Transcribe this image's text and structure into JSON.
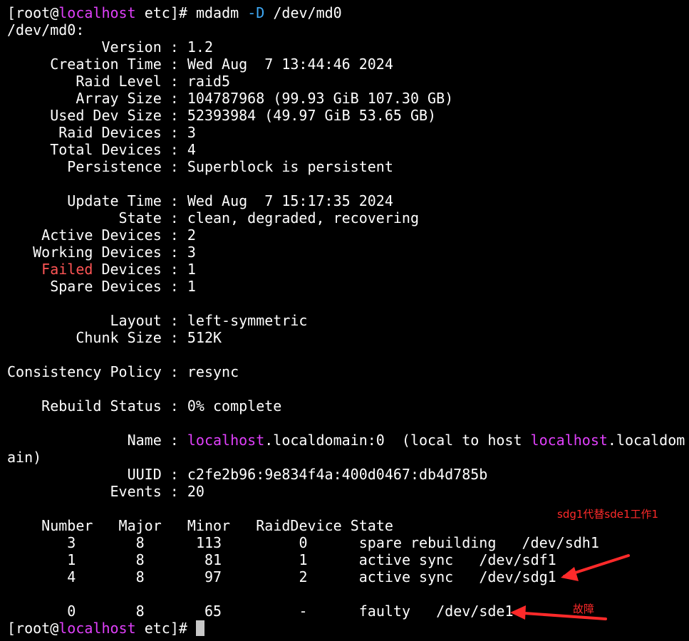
{
  "prompt": {
    "user": "root",
    "host": "localhost",
    "dir": "etc",
    "symbol": "#"
  },
  "command": {
    "name": "mdadm",
    "flag": "-D",
    "target": "/dev/md0"
  },
  "device_header": "/dev/md0:",
  "details1": [
    {
      "key": "Version",
      "value": "1.2"
    },
    {
      "key": "Creation Time",
      "value": "Wed Aug  7 13:44:46 2024"
    },
    {
      "key": "Raid Level",
      "value": "raid5"
    },
    {
      "key": "Array Size",
      "value": "104787968 (99.93 GiB 107.30 GB)"
    },
    {
      "key": "Used Dev Size",
      "value": "52393984 (49.97 GiB 53.65 GB)"
    },
    {
      "key": "Raid Devices",
      "value": "3"
    },
    {
      "key": "Total Devices",
      "value": "4"
    },
    {
      "key": "Persistence",
      "value": "Superblock is persistent"
    }
  ],
  "details2": [
    {
      "key": "Update Time",
      "value": "Wed Aug  7 15:17:35 2024"
    },
    {
      "key": "State",
      "value": "clean, degraded, recovering"
    },
    {
      "key": "Active Devices",
      "value": "2"
    },
    {
      "key": "Working Devices",
      "value": "3"
    },
    {
      "key_prefix": "Failed",
      "key": "Devices",
      "value": "1"
    },
    {
      "key": "Spare Devices",
      "value": "1"
    }
  ],
  "details3": [
    {
      "key": "Layout",
      "value": "left-symmetric"
    },
    {
      "key": "Chunk Size",
      "value": "512K"
    }
  ],
  "consistency": {
    "key": "Consistency Policy",
    "value": "resync"
  },
  "rebuild": {
    "key": "Rebuild Status",
    "value": "0% complete"
  },
  "name": {
    "key": "Name",
    "host1": "localhost",
    "rest1": ".localdomain:0  (local to host ",
    "host2": "localhost",
    "rest2": ".localdom",
    "wrap": "ain)"
  },
  "uuid": {
    "key": "UUID",
    "value": "c2fe2b96:9e834f4a:400d0467:db4d785b"
  },
  "events": {
    "key": "Events",
    "value": "20"
  },
  "table": {
    "headers": [
      "Number",
      "Major",
      "Minor",
      "RaidDevice",
      "State"
    ],
    "rows": [
      {
        "number": "3",
        "major": "8",
        "minor": "113",
        "raid": "0",
        "state": "spare rebuilding",
        "device": "/dev/sdh1"
      },
      {
        "number": "1",
        "major": "8",
        "minor": "81",
        "raid": "1",
        "state": "active sync",
        "device": "/dev/sdf1"
      },
      {
        "number": "4",
        "major": "8",
        "minor": "97",
        "raid": "2",
        "state": "active sync",
        "device": "/dev/sdg1"
      }
    ],
    "faulty": {
      "number": "0",
      "major": "8",
      "minor": "65",
      "raid": "-",
      "state": "faulty",
      "device": "/dev/sde1"
    }
  },
  "annotations": {
    "replace": "sdg1代替sde1工作1",
    "fault": "故障"
  },
  "colors": {
    "background": "#000000",
    "text": "#ffffff",
    "host": "#e040fb",
    "flag": "#3fa9f5",
    "failed": "#ff5555",
    "annotation": "#ff2a2a"
  },
  "icons": {
    "cursor": "block-cursor-icon",
    "arrows": "arrow-icon"
  }
}
